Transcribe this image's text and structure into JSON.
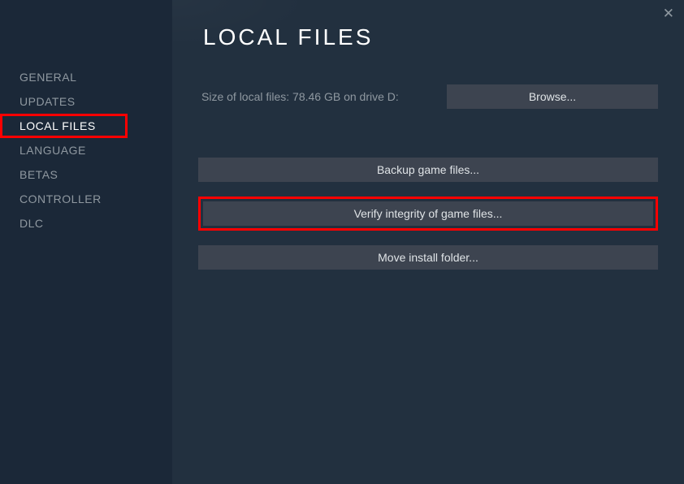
{
  "sidebar": {
    "items": [
      {
        "label": "GENERAL"
      },
      {
        "label": "UPDATES"
      },
      {
        "label": "LOCAL FILES"
      },
      {
        "label": "LANGUAGE"
      },
      {
        "label": "BETAS"
      },
      {
        "label": "CONTROLLER"
      },
      {
        "label": "DLC"
      }
    ]
  },
  "header": {
    "title": "LOCAL FILES"
  },
  "main": {
    "size_text": "Size of local files: 78.46 GB on drive D:",
    "browse_label": "Browse...",
    "backup_label": "Backup game files...",
    "verify_label": "Verify integrity of game files...",
    "move_label": "Move install folder..."
  },
  "close_label": "✕"
}
